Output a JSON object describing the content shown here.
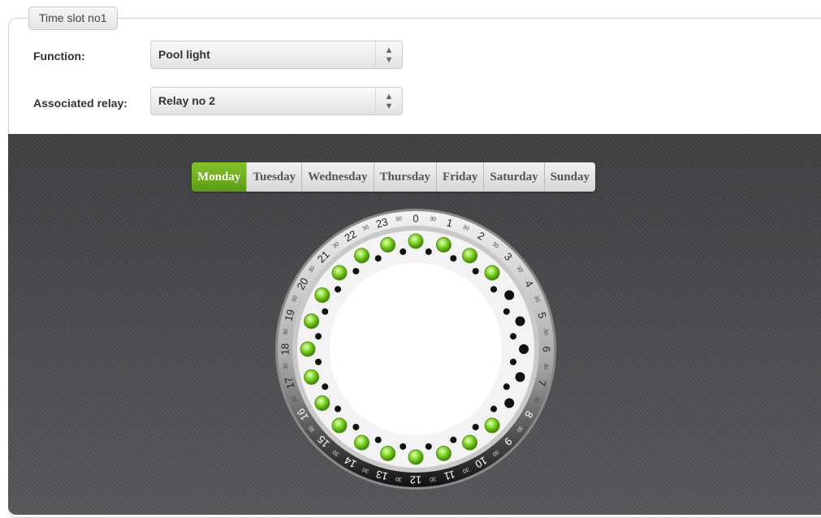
{
  "slot": {
    "title": "Time slot no1"
  },
  "function": {
    "label": "Function:",
    "value": "Pool light"
  },
  "relay": {
    "label": "Associated relay:",
    "value": "Relay no 2"
  },
  "days": [
    "Monday",
    "Tuesday",
    "Wednesday",
    "Thursday",
    "Friday",
    "Saturday",
    "Sunday"
  ],
  "active_day": "Monday",
  "dial": {
    "hours": [
      "0",
      "1",
      "2",
      "3",
      "4",
      "5",
      "6",
      "7",
      "8",
      "9",
      "10",
      "11",
      "12",
      "13",
      "14",
      "15",
      "16",
      "17",
      "18",
      "19",
      "20",
      "21",
      "22",
      "23"
    ],
    "half_label": "30",
    "on_hours": [
      0,
      1,
      2,
      3,
      9,
      10,
      11,
      12,
      13,
      14,
      15,
      16,
      17,
      18,
      19,
      20,
      21,
      22,
      23
    ]
  },
  "colors": {
    "active_tab": "#6cab1d",
    "led_on": "#7ed321",
    "dark_panel": "#4a4b4d"
  }
}
